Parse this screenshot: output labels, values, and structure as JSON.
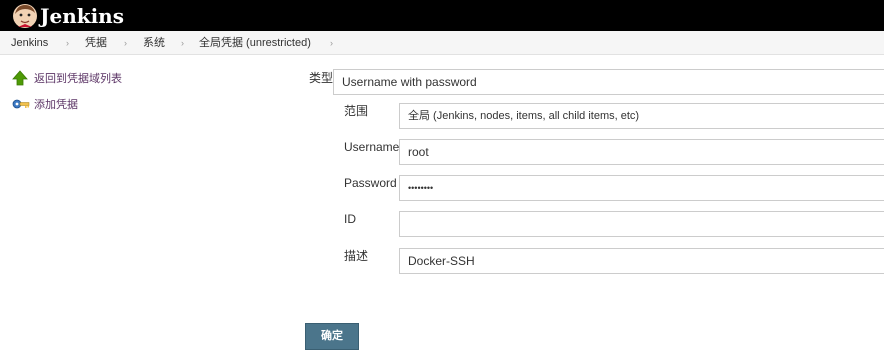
{
  "header": {
    "app_title": "Jenkins",
    "logo_icon": "jenkins-butler-icon"
  },
  "breadcrumb": {
    "items": [
      "Jenkins",
      "凭据",
      "系统",
      "全局凭据 (unrestricted)"
    ],
    "separator": "›"
  },
  "sidebar": {
    "tasks": [
      {
        "label": "返回到凭据域列表",
        "icon": "up-arrow-icon"
      },
      {
        "label": "添加凭据",
        "icon": "key-icon"
      }
    ]
  },
  "form": {
    "kind": {
      "label": "类型",
      "value": "Username with password"
    },
    "scope": {
      "label": "范围",
      "value": "全局 (Jenkins, nodes, items, all child items, etc)"
    },
    "username": {
      "label": "Username",
      "value": "root"
    },
    "password": {
      "label": "Password",
      "value": "••••••••"
    },
    "id": {
      "label": "ID",
      "value": ""
    },
    "description": {
      "label": "描述",
      "value": "Docker-SSH"
    },
    "submit_label": "确定"
  },
  "colors": {
    "header_bg": "#000000",
    "link": "#5c3566",
    "button_bg": "#4b758b",
    "breadcrumb_bg": "#f6f6f6"
  }
}
